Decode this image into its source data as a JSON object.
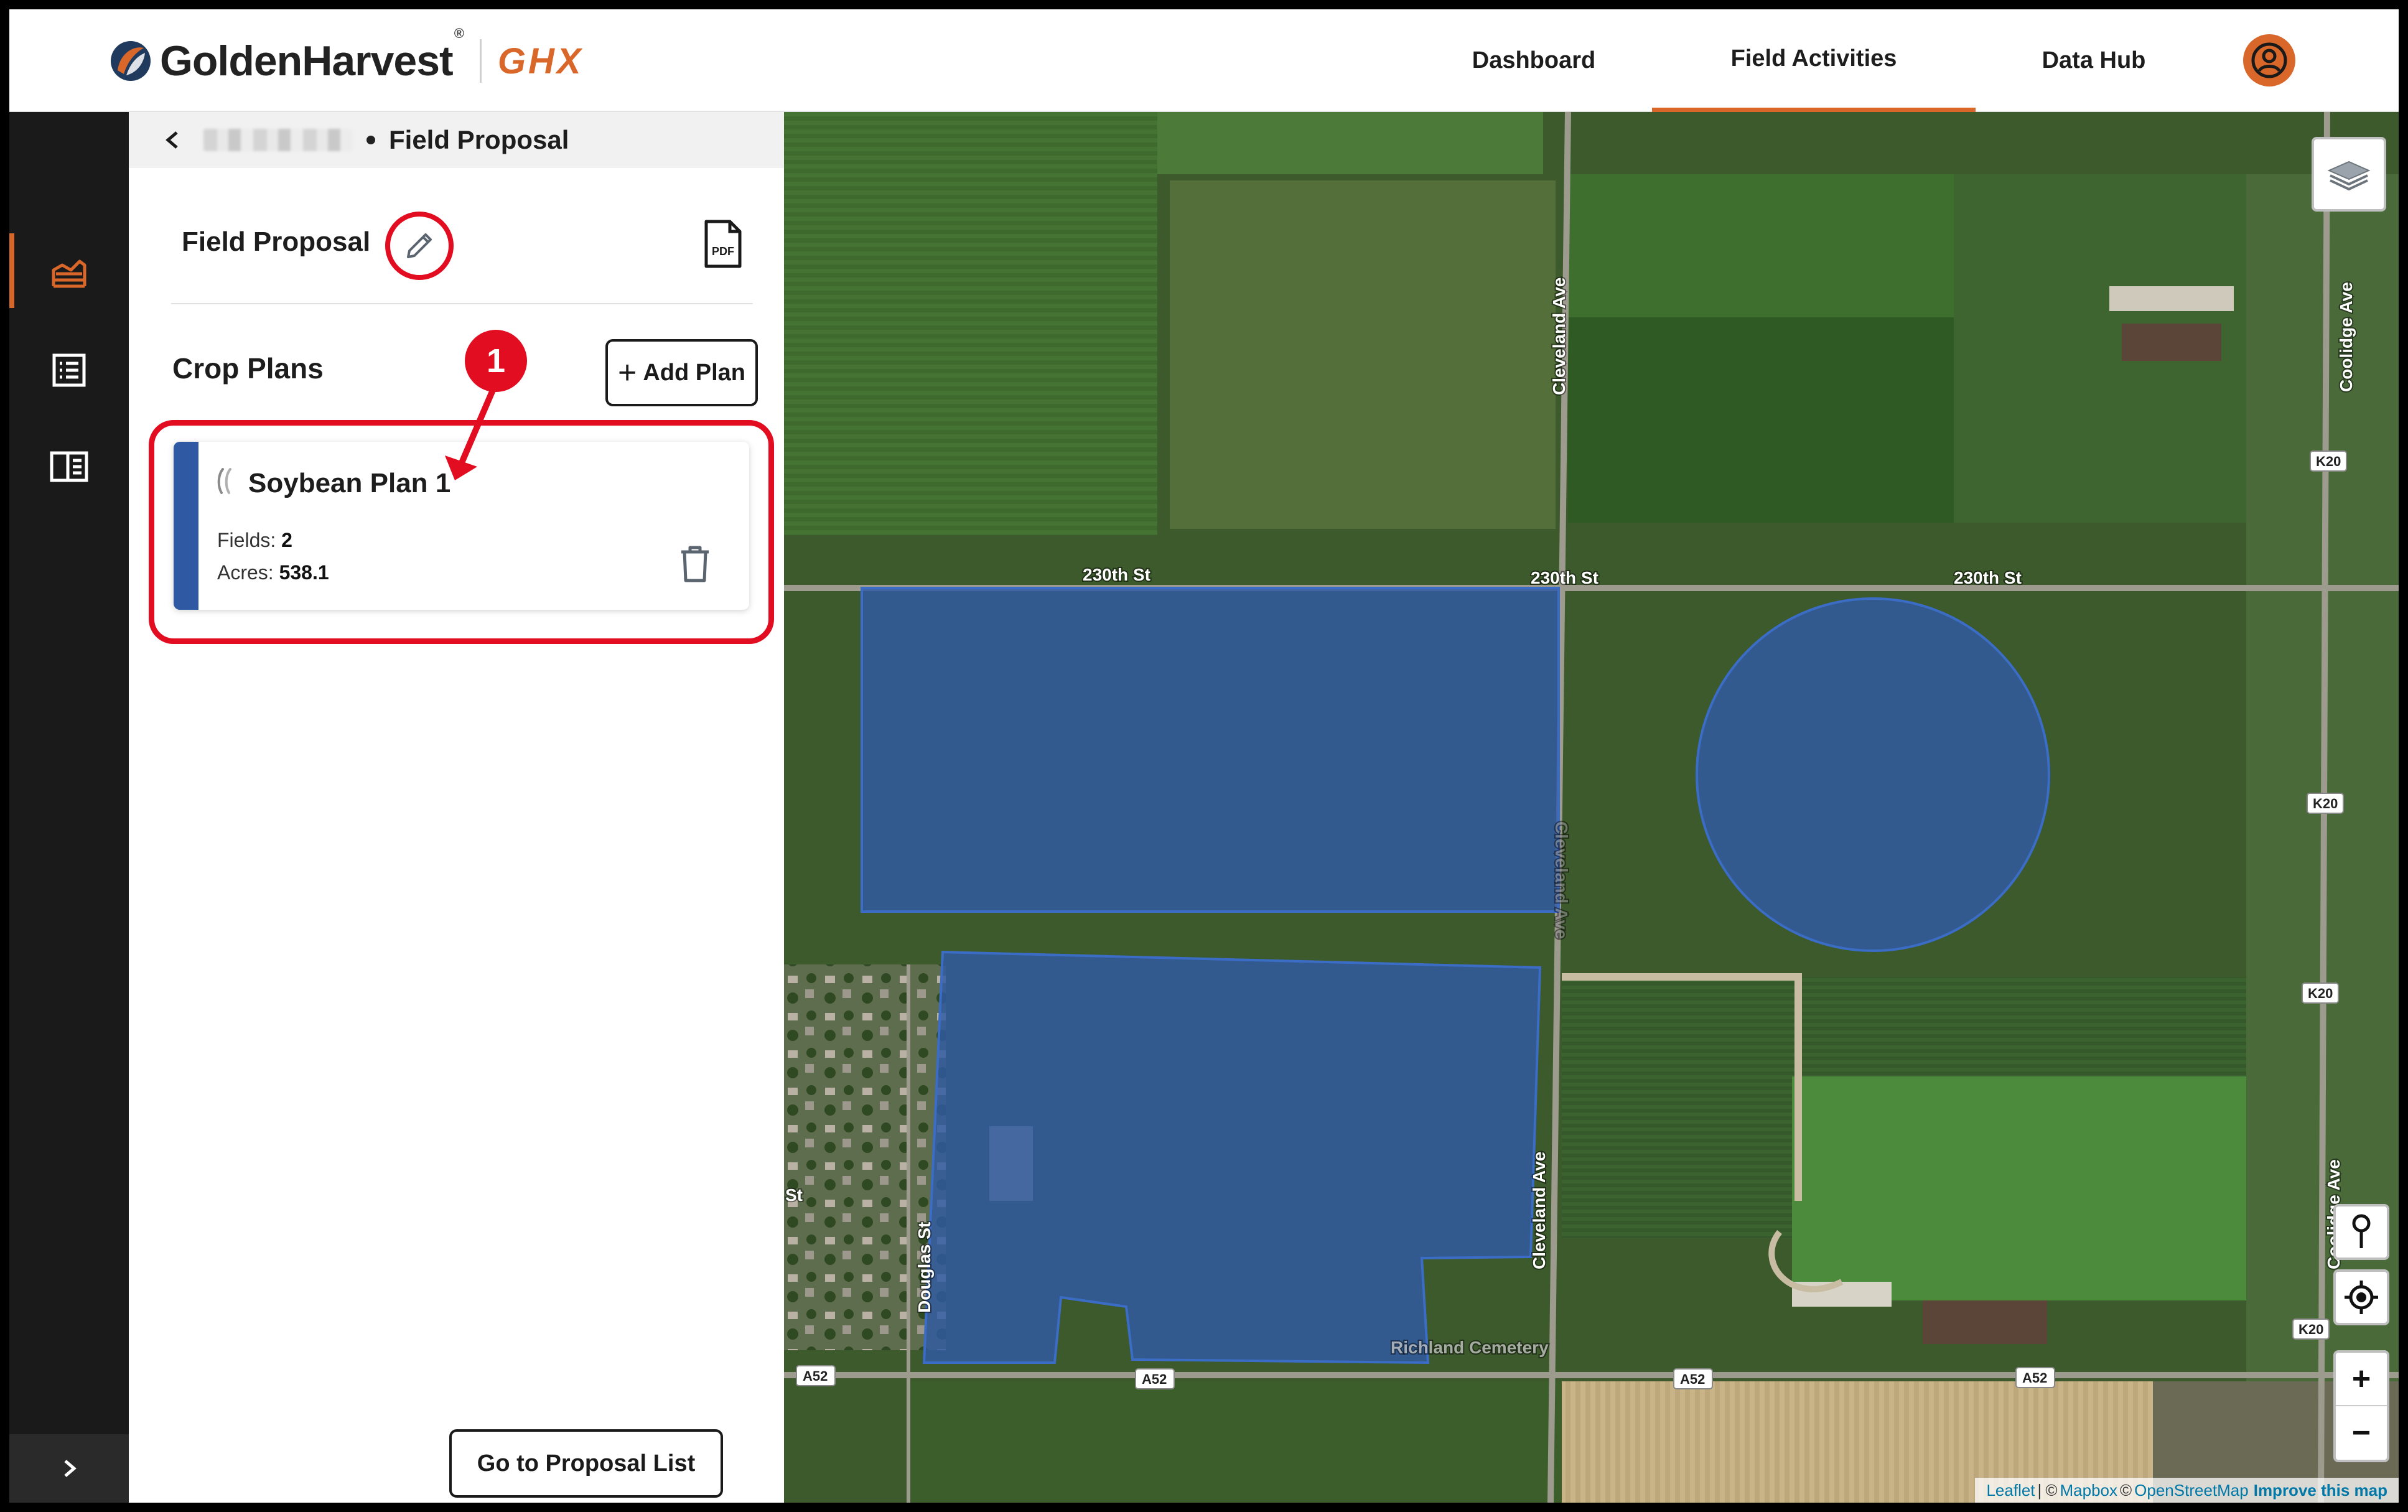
{
  "header": {
    "brand_name": "GoldenHarvest",
    "brand_reg": "®",
    "brand_product": "GHX",
    "nav": [
      {
        "label": "Dashboard"
      },
      {
        "label": "Field Activities",
        "active": true
      },
      {
        "label": "Data Hub"
      }
    ]
  },
  "rail": {
    "icons": [
      "fields-icon",
      "list-icon",
      "panel-icon"
    ],
    "expand_icon": "chevron-right-icon"
  },
  "panel": {
    "breadcrumb": {
      "current": "Field Proposal"
    },
    "proposal_title": "Field Proposal",
    "crop_plans_title": "Crop Plans",
    "add_plan_label": "Add Plan",
    "callout_number": "1",
    "plans": [
      {
        "name": "Soybean Plan 1",
        "fields_label": "Fields:",
        "fields_value": "2",
        "acres_label": "Acres:",
        "acres_value": "538.1",
        "color": "#2f5aa3"
      }
    ],
    "goto_label": "Go to Proposal List"
  },
  "map": {
    "road_labels": {
      "st_230_a": "230th St",
      "st_230_b": "230th St",
      "st_230_c": "230th St",
      "cleveland_a": "Cleveland Ave",
      "cleveland_b": "Cleveland Ave",
      "cleveland_c": "Cleveland Ave",
      "coolidge_a": "Coolidge Ave",
      "coolidge_b": "Coolidge Ave",
      "douglas": "Douglas St",
      "cemetery": "Richland Cemetery",
      "st_left": "St"
    },
    "shields": {
      "k20_a": "K20",
      "k20_b": "K20",
      "k20_c": "K20",
      "k20_d": "K20",
      "a52_a": "A52",
      "a52_b": "A52",
      "a52_c": "A52",
      "a52_d": "A52"
    },
    "zoom_in": "+",
    "zoom_out": "−",
    "attribution": {
      "leaflet": "Leaflet",
      "sep": "|",
      "copy1": "©",
      "mapbox": "Mapbox",
      "copy2": "©",
      "osm": "OpenStreetMap",
      "improve": "Improve this map"
    },
    "field_color": "#2f5aa3"
  },
  "colors": {
    "accent": "#d9672a",
    "annotation": "#e20d20",
    "rail_bg": "#1a1a1a"
  }
}
